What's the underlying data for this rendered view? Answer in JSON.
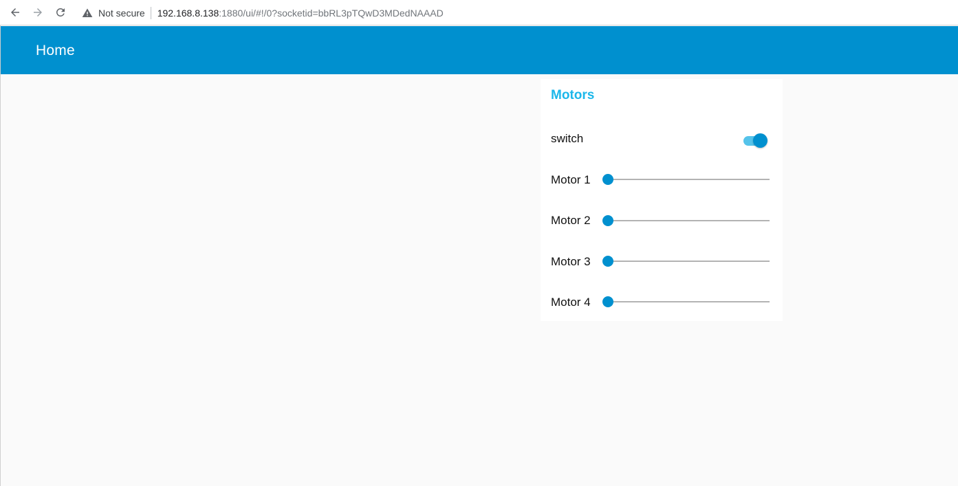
{
  "browser": {
    "security_label": "Not secure",
    "url_host": "192.168.8.138",
    "url_rest": ":1880/ui/#!/0?socketid=bbRL3pTQwD3MDedNAAAD"
  },
  "header": {
    "title": "Home"
  },
  "card": {
    "title": "Motors",
    "switch": {
      "label": "switch",
      "on": true
    },
    "sliders": [
      {
        "label": "Motor 1",
        "value": 0
      },
      {
        "label": "Motor 2",
        "value": 0
      },
      {
        "label": "Motor 3",
        "value": 0
      },
      {
        "label": "Motor 4",
        "value": 0
      }
    ]
  },
  "colors": {
    "accent": "#0090cf",
    "card_title": "#1bb7ea",
    "toggle_track": "#55c3ea"
  }
}
